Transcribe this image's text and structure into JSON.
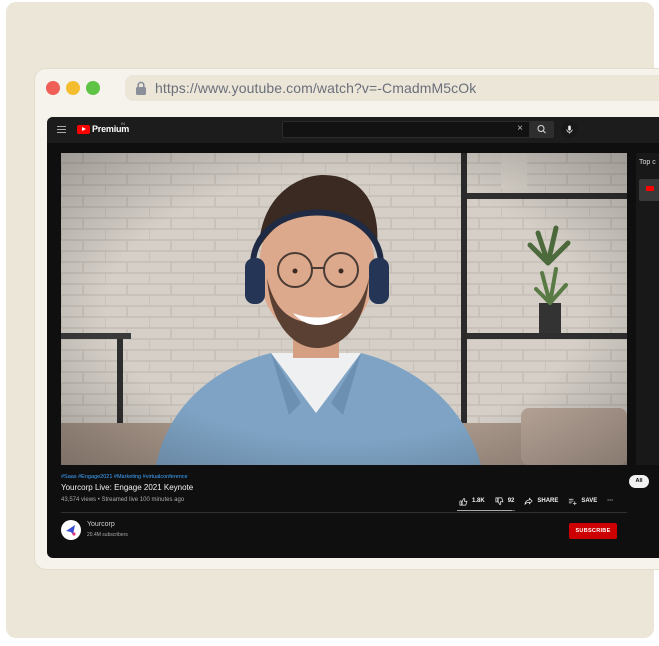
{
  "browser": {
    "url": "https://www.youtube.com/watch?v=-CmadmM5cOk"
  },
  "youtube": {
    "brand": "Premium",
    "brand_sup": "IN",
    "search": {
      "clear_icon": "close-icon",
      "value": ""
    },
    "sidebar": {
      "label": "Top c"
    },
    "filter_chip": "All"
  },
  "video": {
    "tags": "#Saas #Engage2021 #Marketing #virtualconference",
    "title": "Yourcorp Live: Engage 2021 Keynote",
    "meta": "43,574 views • Streamed live 100 minutes ago",
    "likes": "1.8K",
    "dislikes": "92",
    "share_label": "SHARE",
    "save_label": "SAVE",
    "more_label": "···",
    "like_ratio": 0.94
  },
  "channel": {
    "name": "Yourcorp",
    "subscribers": "20.4M subscribers",
    "subscribe_label": "SUBSCRIBE"
  },
  "colors": {
    "accent_red": "#cc0000",
    "link_blue": "#3ea6ff",
    "background": "#ebe6d8"
  }
}
